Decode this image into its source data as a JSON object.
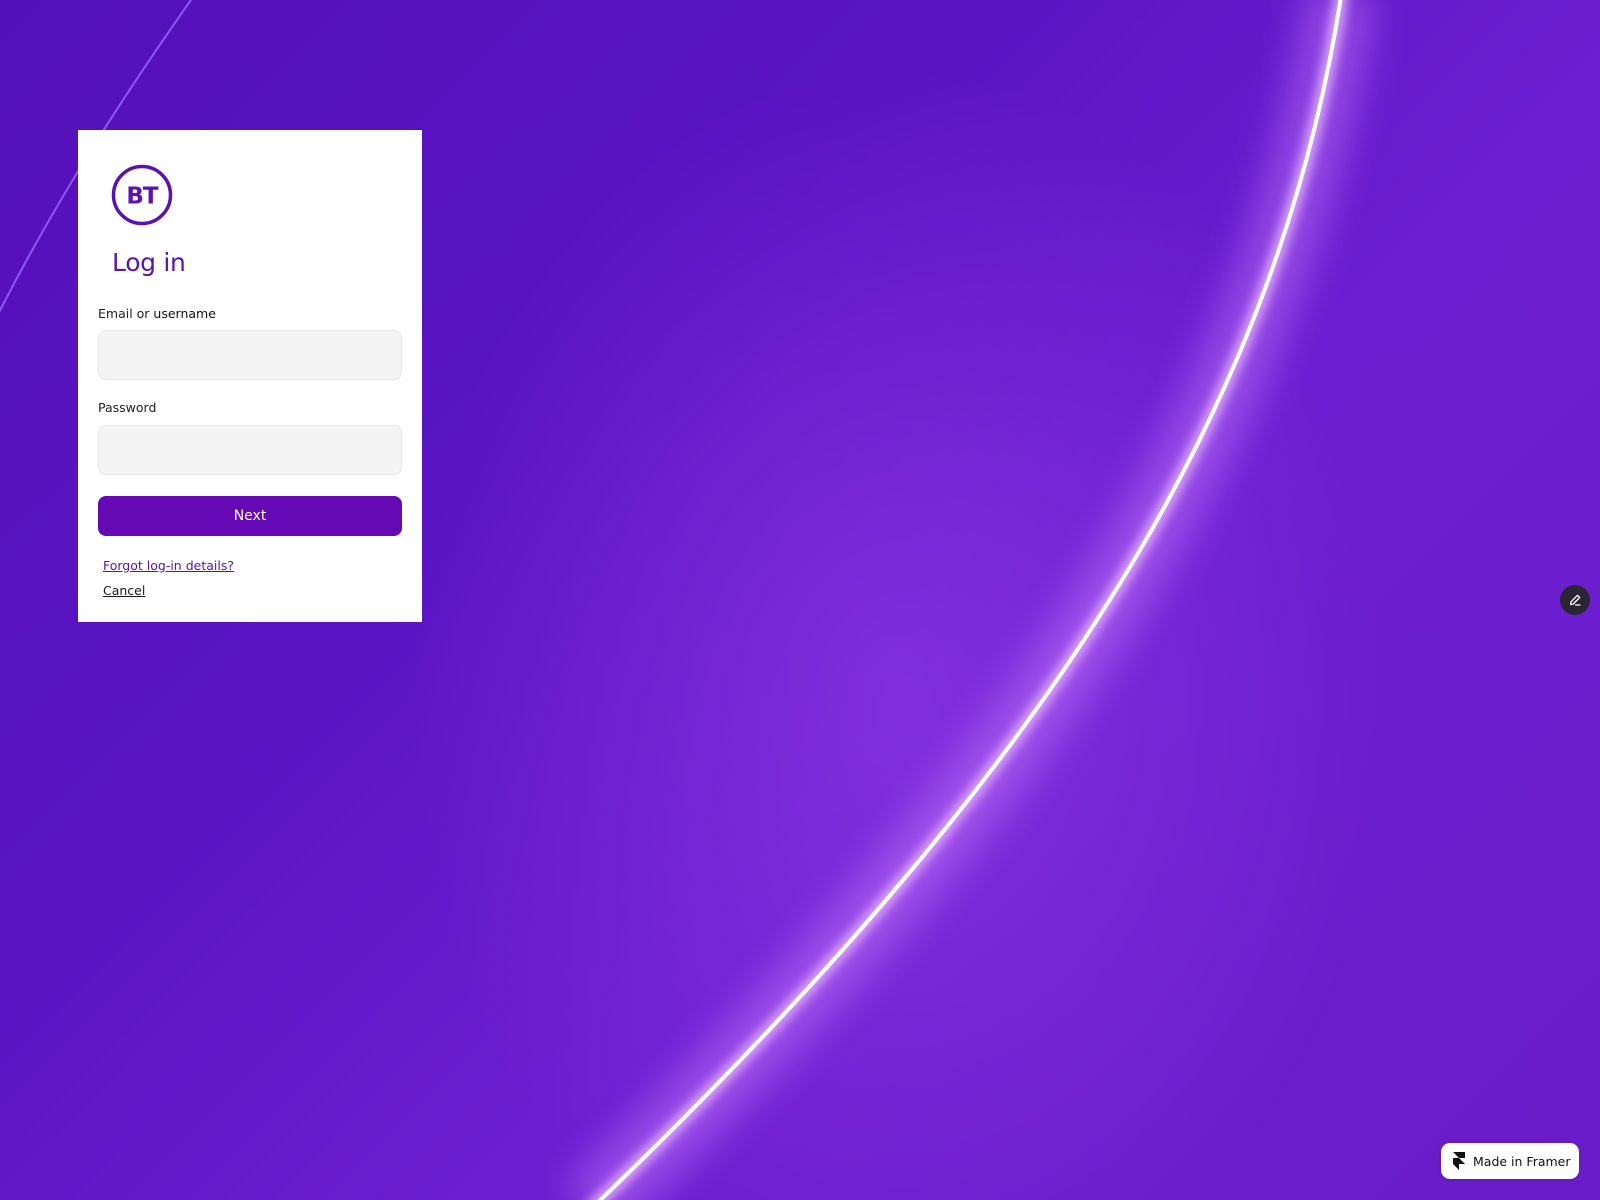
{
  "brand": {
    "logo_text": "BT",
    "logo_color": "#5b12b0"
  },
  "login": {
    "title": "Log in",
    "email_label_prefix": "Email or ",
    "email_label_strong": "username",
    "email_value": "",
    "password_label": "Password",
    "password_value": "",
    "next_label": "Next",
    "forgot_label": "Forgot log-in details?",
    "cancel_label": "Cancel"
  },
  "colors": {
    "primary": "#6409b4",
    "background": "#5a14c4",
    "card": "#ffffff",
    "input_fill": "#f4f4f5"
  },
  "icons": {
    "edit": "pencil-icon",
    "framer": "framer-logo-icon"
  },
  "framer_badge": {
    "label": "Made in Framer"
  }
}
